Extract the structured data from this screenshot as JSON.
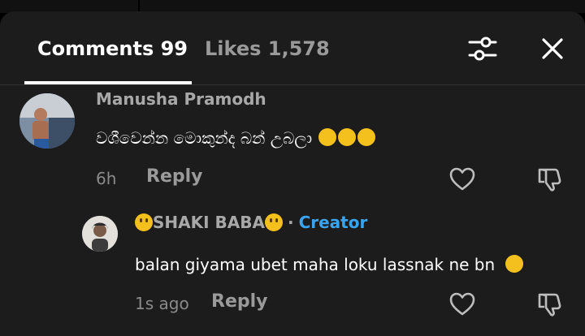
{
  "header": {
    "comments_tab": "Comments 99",
    "likes_tab": "Likes 1,578",
    "filter_icon": "sliders-icon",
    "close_icon": "close-icon"
  },
  "comments": [
    {
      "username": "Manusha Pramodh",
      "text": "වශීවෙන්න මොකුන්ද බන් උබලා",
      "trailing_emoji": "laughing-emoji x3",
      "time": "6h",
      "reply_label": "Reply"
    },
    {
      "username": "SHAKI BABA",
      "creator_label": "Creator",
      "text": "balan giyama ubet maha loku lassnak ne bn",
      "trailing_emoji": "shy-face-emoji",
      "time": "1s ago",
      "reply_label": "Reply"
    }
  ],
  "colors": {
    "panel": "#1c1c1c",
    "creator_badge": "#3aa5ee",
    "muted_text": "#a8a8a8"
  }
}
